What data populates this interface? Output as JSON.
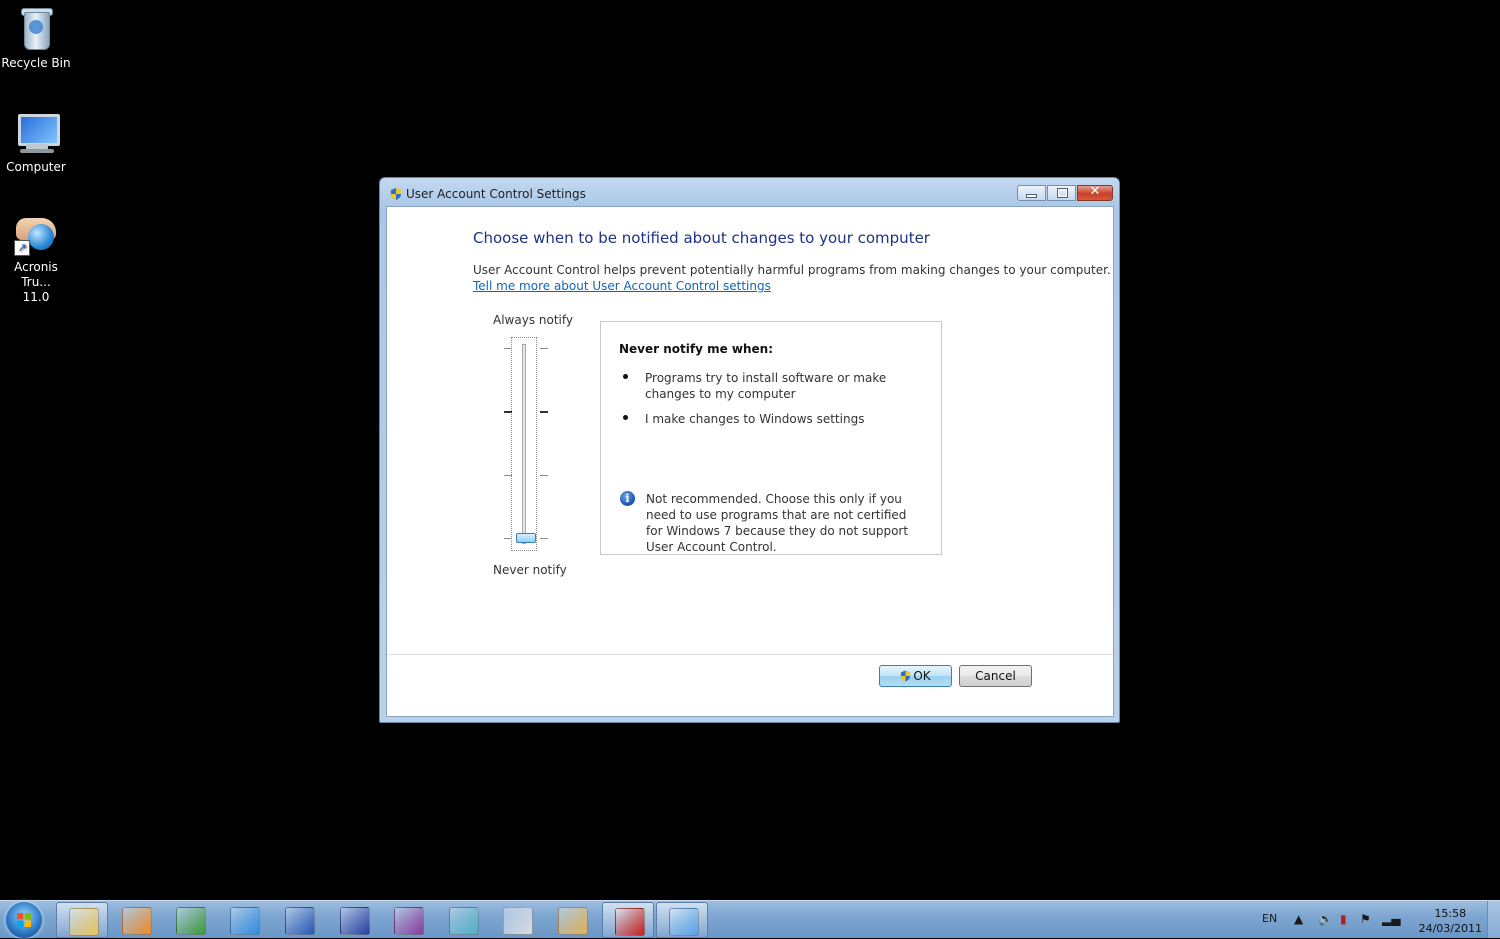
{
  "desktop": {
    "icons": [
      {
        "label": "Recycle Bin"
      },
      {
        "label": "Computer"
      },
      {
        "label_line1": "Acronis Tru...",
        "label_line2": "11.0"
      }
    ]
  },
  "window": {
    "title": "User Account Control Settings",
    "heading": "Choose when to be notified about changes to your computer",
    "description": "User Account Control helps prevent potentially harmful programs from making changes to your computer.",
    "link": "Tell me more about User Account Control settings",
    "slider": {
      "top_label": "Always notify",
      "bottom_label": "Never notify",
      "levels": 4,
      "selected_level": 1
    },
    "panel": {
      "title": "Never notify me when:",
      "bullets": [
        "Programs try to install software or make changes to my computer",
        "I make changes to Windows settings"
      ],
      "info_icon": "info-icon",
      "info_text": "Not recommended. Choose this only if you need to use programs that are not certified for Windows 7 because they do not support User Account Control."
    },
    "buttons": {
      "ok": "OK",
      "cancel": "Cancel"
    }
  },
  "taskbar": {
    "language": "EN",
    "time": "15:58",
    "date": "24/03/2011",
    "pinned": [
      {
        "name": "windows-explorer-icon",
        "color": "#e9c458"
      },
      {
        "name": "media-player-icon",
        "color": "#f08a24"
      },
      {
        "name": "chrome-icon",
        "color": "#3d9b3a"
      },
      {
        "name": "internet-explorer-icon",
        "color": "#2f8ee0"
      },
      {
        "name": "word-icon",
        "color": "#2a5ab8"
      },
      {
        "name": "save-disk-icon",
        "color": "#2c3fa0"
      },
      {
        "name": "onenote-icon",
        "color": "#8a3b9e"
      },
      {
        "name": "snipping-tool-icon",
        "color": "#4fb0c6"
      },
      {
        "name": "calculator-icon",
        "color": "#d8dde3"
      },
      {
        "name": "control-panel-icon",
        "color": "#e3b254"
      },
      {
        "name": "acrobat-icon",
        "color": "#c8201c"
      },
      {
        "name": "uac-settings-icon",
        "color": "#5aa5e8"
      }
    ]
  }
}
